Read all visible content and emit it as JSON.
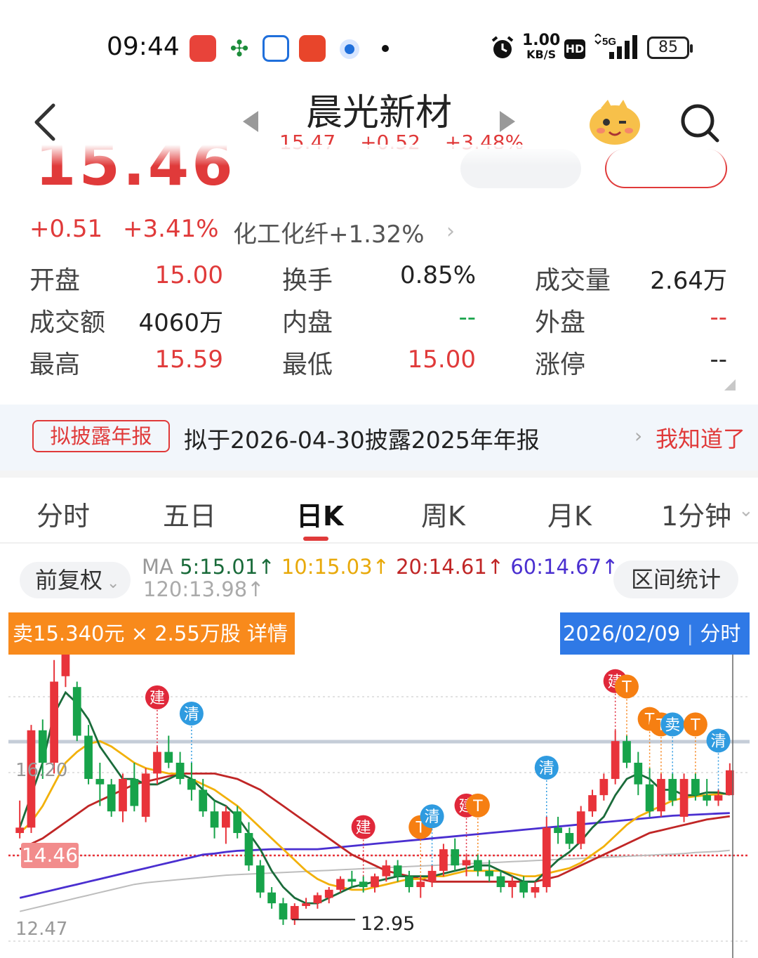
{
  "status_bar": {
    "time": "09:44",
    "net_speed_value": "1.00",
    "net_speed_unit": "KB/S",
    "hd_badge": "HD",
    "network": "5G",
    "battery": "85",
    "icons": [
      "notes-app-icon",
      "railway-app-icon",
      "bank-app-icon",
      "game-app-icon",
      "browser-app-icon",
      "dot-icon",
      "alarm-icon",
      "signal-icon",
      "battery-icon"
    ]
  },
  "header": {
    "title": "晨光新材",
    "price": "15.47",
    "change": "+0.52",
    "change_pct": "+3.48%"
  },
  "quote": {
    "big_price": "15.46",
    "change": "+0.51",
    "change_pct": "+3.41%",
    "industry": "化工化纤+1.32%",
    "rows": [
      [
        {
          "label": "开盘",
          "value": "15.00",
          "color": "red"
        },
        {
          "label": "换手",
          "value": "0.85%",
          "color": "dark"
        },
        {
          "label": "成交量",
          "value": "2.64万",
          "color": "dark"
        }
      ],
      [
        {
          "label": "成交额",
          "value": "4060万",
          "color": "dark"
        },
        {
          "label": "内盘",
          "value": "--",
          "color": "green"
        },
        {
          "label": "外盘",
          "value": "--",
          "color": "red"
        }
      ],
      [
        {
          "label": "最高",
          "value": "15.59",
          "color": "red"
        },
        {
          "label": "最低",
          "value": "15.00",
          "color": "red"
        },
        {
          "label": "涨停",
          "value": "--",
          "color": "dark"
        }
      ]
    ]
  },
  "notice": {
    "tag": "拟披露年报",
    "text": "拟于2026-04-30披露2025年年报",
    "action": "我知道了"
  },
  "tabs": [
    "分时",
    "五日",
    "日K",
    "周K",
    "月K",
    "1分钟"
  ],
  "active_tab": "日K",
  "chart_toolbar": {
    "adjust": "前复权",
    "ma_prefix": "MA",
    "ma5": "5:15.01",
    "ma10": "10:15.03",
    "ma20": "20:14.61",
    "ma60": "60:14.67",
    "ma120": "120:13.98",
    "stats_button": "区间统计"
  },
  "chart_banner": {
    "sell_info": "卖15.340元 × 2.55万股 详情",
    "date": "2026/02/09",
    "intraday": "分时"
  },
  "chart_data": {
    "type": "candlestick",
    "axis_labels": {
      "upper": "16.20",
      "lower": "12.47"
    },
    "current_price_tag": "14.46",
    "low_marker": "12.95",
    "ylim": [
      12.3,
      17.6
    ],
    "colors": {
      "up": "#e8333a",
      "down": "#17a34a",
      "ma5": "#1a6b3a",
      "ma10": "#f2b10a",
      "ma20": "#c02626",
      "ma60": "#4a2fd0",
      "ma120": "#bdbdbd"
    },
    "candles": [
      {
        "o": 14.3,
        "h": 14.9,
        "l": 14.2,
        "c": 14.4
      },
      {
        "o": 14.4,
        "h": 16.3,
        "l": 14.3,
        "c": 16.2
      },
      {
        "o": 16.2,
        "h": 16.4,
        "l": 15.3,
        "c": 15.6
      },
      {
        "o": 15.6,
        "h": 17.5,
        "l": 15.4,
        "c": 17.1
      },
      {
        "o": 17.2,
        "h": 17.8,
        "l": 17.0,
        "c": 17.6
      },
      {
        "o": 17.0,
        "h": 17.1,
        "l": 16.0,
        "c": 16.1
      },
      {
        "o": 16.1,
        "h": 16.3,
        "l": 15.2,
        "c": 15.3
      },
      {
        "o": 15.3,
        "h": 15.6,
        "l": 14.8,
        "c": 15.2
      },
      {
        "o": 15.2,
        "h": 15.3,
        "l": 14.6,
        "c": 14.7
      },
      {
        "o": 14.7,
        "h": 15.4,
        "l": 14.5,
        "c": 15.3
      },
      {
        "o": 15.3,
        "h": 15.6,
        "l": 14.7,
        "c": 14.8
      },
      {
        "o": 14.6,
        "h": 15.5,
        "l": 14.5,
        "c": 15.4
      },
      {
        "o": 15.4,
        "h": 15.9,
        "l": 15.2,
        "c": 15.8
      },
      {
        "o": 15.8,
        "h": 16.1,
        "l": 15.5,
        "c": 15.6
      },
      {
        "o": 15.6,
        "h": 15.8,
        "l": 15.2,
        "c": 15.3
      },
      {
        "o": 15.3,
        "h": 15.6,
        "l": 14.9,
        "c": 15.1
      },
      {
        "o": 15.1,
        "h": 15.3,
        "l": 14.6,
        "c": 14.7
      },
      {
        "o": 14.7,
        "h": 14.9,
        "l": 14.2,
        "c": 14.4
      },
      {
        "o": 14.4,
        "h": 14.8,
        "l": 14.1,
        "c": 14.7
      },
      {
        "o": 14.7,
        "h": 14.8,
        "l": 14.2,
        "c": 14.3
      },
      {
        "o": 14.3,
        "h": 14.5,
        "l": 13.6,
        "c": 13.7
      },
      {
        "o": 13.7,
        "h": 13.8,
        "l": 13.1,
        "c": 13.2
      },
      {
        "o": 13.2,
        "h": 13.3,
        "l": 12.9,
        "c": 13.0
      },
      {
        "o": 13.0,
        "h": 13.1,
        "l": 12.6,
        "c": 12.7
      },
      {
        "o": 12.7,
        "h": 13.0,
        "l": 12.6,
        "c": 12.95
      },
      {
        "o": 12.95,
        "h": 13.1,
        "l": 12.9,
        "c": 13.0
      },
      {
        "o": 13.0,
        "h": 13.2,
        "l": 12.9,
        "c": 13.15
      },
      {
        "o": 13.1,
        "h": 13.3,
        "l": 13.0,
        "c": 13.25
      },
      {
        "o": 13.25,
        "h": 13.5,
        "l": 13.2,
        "c": 13.45
      },
      {
        "o": 13.45,
        "h": 13.6,
        "l": 13.3,
        "c": 13.4
      },
      {
        "o": 13.4,
        "h": 13.5,
        "l": 13.2,
        "c": 13.3
      },
      {
        "o": 13.3,
        "h": 13.55,
        "l": 13.2,
        "c": 13.5
      },
      {
        "o": 13.5,
        "h": 13.8,
        "l": 13.4,
        "c": 13.7
      },
      {
        "o": 13.7,
        "h": 13.8,
        "l": 13.4,
        "c": 13.5
      },
      {
        "o": 13.5,
        "h": 13.6,
        "l": 13.2,
        "c": 13.3
      },
      {
        "o": 13.3,
        "h": 13.5,
        "l": 13.1,
        "c": 13.4
      },
      {
        "o": 13.4,
        "h": 13.7,
        "l": 13.3,
        "c": 13.6
      },
      {
        "o": 13.6,
        "h": 14.1,
        "l": 13.5,
        "c": 14.0
      },
      {
        "o": 14.0,
        "h": 14.2,
        "l": 13.6,
        "c": 13.7
      },
      {
        "o": 13.7,
        "h": 13.9,
        "l": 13.5,
        "c": 13.8
      },
      {
        "o": 13.8,
        "h": 13.9,
        "l": 13.5,
        "c": 13.6
      },
      {
        "o": 13.6,
        "h": 13.8,
        "l": 13.4,
        "c": 13.5
      },
      {
        "o": 13.5,
        "h": 13.6,
        "l": 13.2,
        "c": 13.3
      },
      {
        "o": 13.3,
        "h": 13.5,
        "l": 13.1,
        "c": 13.4
      },
      {
        "o": 13.4,
        "h": 13.5,
        "l": 13.1,
        "c": 13.2
      },
      {
        "o": 13.2,
        "h": 13.4,
        "l": 13.1,
        "c": 13.3
      },
      {
        "o": 13.3,
        "h": 14.6,
        "l": 13.2,
        "c": 14.4
      },
      {
        "o": 14.4,
        "h": 14.6,
        "l": 14.1,
        "c": 14.3
      },
      {
        "o": 14.3,
        "h": 14.4,
        "l": 14.0,
        "c": 14.1
      },
      {
        "o": 14.1,
        "h": 14.8,
        "l": 14.0,
        "c": 14.7
      },
      {
        "o": 14.7,
        "h": 15.1,
        "l": 14.6,
        "c": 15.0
      },
      {
        "o": 15.0,
        "h": 15.4,
        "l": 14.9,
        "c": 15.3
      },
      {
        "o": 15.3,
        "h": 16.2,
        "l": 15.2,
        "c": 16.0
      },
      {
        "o": 16.0,
        "h": 16.1,
        "l": 15.5,
        "c": 15.6
      },
      {
        "o": 15.6,
        "h": 15.8,
        "l": 15.0,
        "c": 15.2
      },
      {
        "o": 15.2,
        "h": 15.5,
        "l": 14.6,
        "c": 14.7
      },
      {
        "o": 14.7,
        "h": 15.4,
        "l": 14.6,
        "c": 15.3
      },
      {
        "o": 15.3,
        "h": 15.4,
        "l": 14.8,
        "c": 14.9
      },
      {
        "o": 14.6,
        "h": 15.4,
        "l": 14.5,
        "c": 15.3
      },
      {
        "o": 15.3,
        "h": 15.4,
        "l": 14.9,
        "c": 15.0
      },
      {
        "o": 15.0,
        "h": 15.3,
        "l": 14.8,
        "c": 14.9
      },
      {
        "o": 14.9,
        "h": 15.1,
        "l": 14.8,
        "c": 15.0
      },
      {
        "o": 15.0,
        "h": 15.59,
        "l": 15.0,
        "c": 15.46
      }
    ],
    "ma_lines": {
      "ma5": [
        14.4,
        15.0,
        15.6,
        16.5,
        16.9,
        16.7,
        16.4,
        15.9,
        15.6,
        15.3,
        15.3,
        15.2,
        15.2,
        15.3,
        15.4,
        15.3,
        15.1,
        14.9,
        14.8,
        14.6,
        14.3,
        14.0,
        13.6,
        13.3,
        13.1,
        13.0,
        13.0,
        13.1,
        13.2,
        13.3,
        13.35,
        13.4,
        13.45,
        13.5,
        13.5,
        13.5,
        13.5,
        13.55,
        13.6,
        13.65,
        13.7,
        13.7,
        13.6,
        13.5,
        13.4,
        13.4,
        13.6,
        13.8,
        13.95,
        14.15,
        14.4,
        14.6,
        15.0,
        15.3,
        15.4,
        15.3,
        15.1,
        15.1,
        15.0,
        15.0,
        15.05,
        15.05,
        15.01
      ],
      "ma10": [
        14.3,
        14.5,
        14.8,
        15.2,
        15.6,
        15.8,
        15.95,
        16.0,
        15.9,
        15.75,
        15.6,
        15.5,
        15.45,
        15.4,
        15.4,
        15.3,
        15.2,
        15.1,
        14.95,
        14.8,
        14.6,
        14.4,
        14.2,
        14.0,
        13.8,
        13.6,
        13.45,
        13.35,
        13.3,
        13.25,
        13.25,
        13.3,
        13.35,
        13.4,
        13.45,
        13.45,
        13.5,
        13.5,
        13.55,
        13.6,
        13.6,
        13.6,
        13.6,
        13.55,
        13.5,
        13.5,
        13.55,
        13.6,
        13.65,
        13.75,
        13.9,
        14.05,
        14.25,
        14.45,
        14.6,
        14.7,
        14.8,
        14.9,
        14.95,
        14.98,
        15.0,
        15.02,
        15.03
      ],
      "ma20": [
        14.0,
        14.1,
        14.2,
        14.35,
        14.5,
        14.65,
        14.8,
        14.9,
        15.0,
        15.1,
        15.2,
        15.25,
        15.3,
        15.35,
        15.4,
        15.4,
        15.4,
        15.4,
        15.35,
        15.3,
        15.2,
        15.1,
        14.95,
        14.8,
        14.65,
        14.5,
        14.35,
        14.2,
        14.05,
        13.9,
        13.8,
        13.7,
        13.6,
        13.55,
        13.5,
        13.45,
        13.4,
        13.4,
        13.4,
        13.4,
        13.4,
        13.4,
        13.4,
        13.4,
        13.4,
        13.4,
        13.45,
        13.5,
        13.6,
        13.7,
        13.8,
        13.9,
        14.0,
        14.1,
        14.2,
        14.3,
        14.35,
        14.4,
        14.45,
        14.5,
        14.55,
        14.58,
        14.61
      ],
      "ma60": [
        13.1,
        13.15,
        13.2,
        13.25,
        13.3,
        13.35,
        13.4,
        13.45,
        13.5,
        13.55,
        13.6,
        13.65,
        13.7,
        13.75,
        13.8,
        13.85,
        13.9,
        13.92,
        13.95,
        13.97,
        13.98,
        13.99,
        14.0,
        14.0,
        14.0,
        14.0,
        14.0,
        14.02,
        14.04,
        14.06,
        14.08,
        14.1,
        14.12,
        14.14,
        14.16,
        14.18,
        14.2,
        14.22,
        14.24,
        14.26,
        14.28,
        14.3,
        14.32,
        14.34,
        14.36,
        14.38,
        14.4,
        14.42,
        14.44,
        14.46,
        14.48,
        14.5,
        14.52,
        14.54,
        14.56,
        14.58,
        14.6,
        14.62,
        14.63,
        14.64,
        14.65,
        14.66,
        14.67
      ],
      "ma120": [
        12.85,
        12.9,
        12.95,
        13.0,
        13.05,
        13.1,
        13.15,
        13.2,
        13.25,
        13.3,
        13.35,
        13.38,
        13.4,
        13.42,
        13.44,
        13.46,
        13.48,
        13.5,
        13.52,
        13.53,
        13.54,
        13.55,
        13.56,
        13.57,
        13.58,
        13.59,
        13.6,
        13.61,
        13.62,
        13.63,
        13.64,
        13.65,
        13.66,
        13.67,
        13.68,
        13.69,
        13.7,
        13.71,
        13.72,
        13.73,
        13.74,
        13.75,
        13.76,
        13.77,
        13.78,
        13.79,
        13.8,
        13.81,
        13.82,
        13.83,
        13.84,
        13.85,
        13.86,
        13.87,
        13.88,
        13.89,
        13.9,
        13.91,
        13.92,
        13.94,
        13.95,
        13.96,
        13.98
      ]
    },
    "trade_markers": [
      {
        "idx": 12,
        "label": "建",
        "color": "#e0283a"
      },
      {
        "idx": 15,
        "label": "清",
        "color": "#2f9be0"
      },
      {
        "idx": 30,
        "label": "建",
        "color": "#e0283a"
      },
      {
        "idx": 35,
        "label": "T",
        "color": "#f67f12"
      },
      {
        "idx": 36,
        "label": "清",
        "color": "#2f9be0"
      },
      {
        "idx": 39,
        "label": "建",
        "color": "#e0283a"
      },
      {
        "idx": 40,
        "label": "T",
        "color": "#f67f12"
      },
      {
        "idx": 46,
        "label": "清",
        "color": "#2f9be0"
      },
      {
        "idx": 52,
        "label": "建",
        "color": "#e0283a"
      },
      {
        "idx": 53,
        "label": "T",
        "color": "#f67f12"
      },
      {
        "idx": 55,
        "label": "T",
        "color": "#f67f12"
      },
      {
        "idx": 56,
        "label": "T",
        "color": "#f67f12"
      },
      {
        "idx": 57,
        "label": "卖",
        "color": "#2f9be0"
      },
      {
        "idx": 59,
        "label": "T",
        "color": "#f67f12"
      },
      {
        "idx": 61,
        "label": "清",
        "color": "#2f9be0"
      }
    ]
  }
}
